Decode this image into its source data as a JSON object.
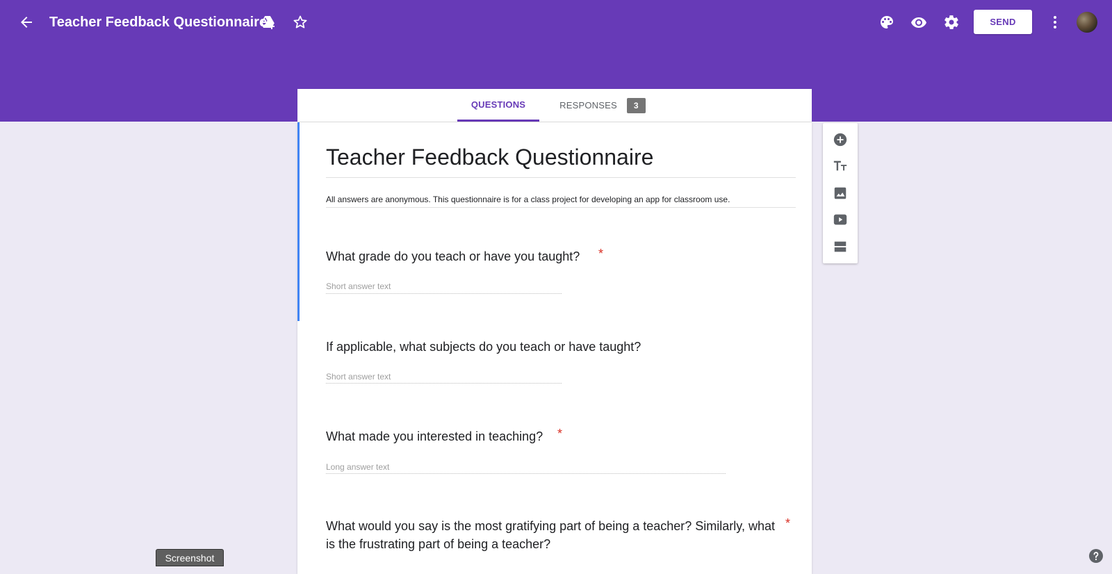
{
  "header": {
    "title": "Teacher Feedback Questionnaire",
    "send_label": "SEND",
    "icons": [
      "back-arrow-icon",
      "drive-add-icon",
      "star-icon",
      "palette-icon",
      "preview-eye-icon",
      "settings-gear-icon",
      "more-vert-icon",
      "avatar"
    ],
    "brand_color": "#673ab7"
  },
  "tabs": {
    "questions_label": "QUESTIONS",
    "responses_label": "RESPONSES",
    "responses_count": "3",
    "active": "QUESTIONS"
  },
  "form": {
    "title": "Teacher Feedback Questionnaire",
    "description": "All answers are anonymous. This questionnaire is for a class project for developing an app for classroom use.",
    "questions": [
      {
        "text": "What grade do you teach or have you taught?",
        "required": true,
        "hint": "Short answer text"
      },
      {
        "text": "If applicable, what subjects do you teach or have taught?",
        "required": false,
        "hint": "Short answer text"
      },
      {
        "text": "What made you interested in teaching?",
        "required": true,
        "hint": "Long answer text"
      },
      {
        "text": "What would you say is the most gratifying part of being a teacher? Similarly, what is the frustrating part of being a teacher?",
        "required": true
      }
    ],
    "required_mark": "*"
  },
  "side_toolbar": [
    "add-question-icon",
    "add-title-icon",
    "add-image-icon",
    "add-video-icon",
    "add-section-icon"
  ],
  "footer": {
    "screenshot_label": "Screenshot",
    "help_icon": "help-icon"
  }
}
